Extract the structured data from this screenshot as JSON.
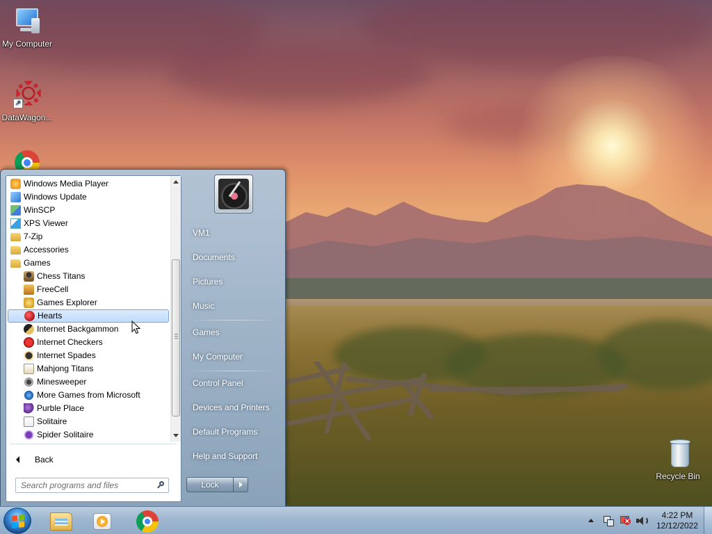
{
  "desktop": {
    "icons": [
      {
        "label": "My Computer",
        "icon": "my-computer-icon"
      },
      {
        "label": "DataWagon...",
        "icon": "datawagon-icon"
      },
      {
        "label": "Google Chrome",
        "icon": "chrome-icon"
      },
      {
        "label": "Recycle Bin",
        "icon": "recycle-bin-icon"
      }
    ]
  },
  "start_menu": {
    "programs": [
      {
        "label": "Windows Media Player",
        "icon": "windows-media-player-icon",
        "indent": 0
      },
      {
        "label": "Windows Update",
        "icon": "windows-update-icon",
        "indent": 0
      },
      {
        "label": "WinSCP",
        "icon": "winscp-icon",
        "indent": 0
      },
      {
        "label": "XPS Viewer",
        "icon": "xps-viewer-icon",
        "indent": 0
      },
      {
        "label": "7-Zip",
        "icon": "folder-icon",
        "indent": 0
      },
      {
        "label": "Accessories",
        "icon": "folder-icon",
        "indent": 0
      },
      {
        "label": "Games",
        "icon": "folder-icon",
        "indent": 0
      },
      {
        "label": "Chess Titans",
        "icon": "chess-titans-icon",
        "indent": 1
      },
      {
        "label": "FreeCell",
        "icon": "freecell-icon",
        "indent": 1
      },
      {
        "label": "Games Explorer",
        "icon": "games-explorer-icon",
        "indent": 1
      },
      {
        "label": "Hearts",
        "icon": "hearts-icon",
        "indent": 1,
        "selected": true
      },
      {
        "label": "Internet Backgammon",
        "icon": "internet-backgammon-icon",
        "indent": 1
      },
      {
        "label": "Internet Checkers",
        "icon": "internet-checkers-icon",
        "indent": 1
      },
      {
        "label": "Internet Spades",
        "icon": "internet-spades-icon",
        "indent": 1
      },
      {
        "label": "Mahjong Titans",
        "icon": "mahjong-titans-icon",
        "indent": 1
      },
      {
        "label": "Minesweeper",
        "icon": "minesweeper-icon",
        "indent": 1
      },
      {
        "label": "More Games from Microsoft",
        "icon": "more-games-icon",
        "indent": 1
      },
      {
        "label": "Purble Place",
        "icon": "purble-place-icon",
        "indent": 1
      },
      {
        "label": "Solitaire",
        "icon": "solitaire-icon",
        "indent": 1
      },
      {
        "label": "Spider Solitaire",
        "icon": "spider-solitaire-icon",
        "indent": 1
      }
    ],
    "back_label": "Back",
    "search_placeholder": "Search programs and files",
    "user_name": "VM1",
    "right_items": [
      {
        "label": "Documents"
      },
      {
        "label": "Pictures"
      },
      {
        "label": "Music"
      },
      {
        "label": "Games"
      },
      {
        "label": "My Computer"
      },
      {
        "label": "Control Panel"
      },
      {
        "label": "Devices and Printers"
      },
      {
        "label": "Default Programs"
      },
      {
        "label": "Help and Support"
      }
    ],
    "lock_label": "Lock"
  },
  "taskbar": {
    "pinned": [
      {
        "name": "windows-explorer",
        "icon": "windows-explorer-icon"
      },
      {
        "name": "windows-media-player",
        "icon": "windows-media-player-icon"
      },
      {
        "name": "google-chrome",
        "icon": "chrome-icon"
      }
    ],
    "clock_time": "4:22 PM",
    "clock_date": "12/12/2022"
  },
  "colors": {
    "menu_selection": "#c1dcfc",
    "menu_frame": "#8da6c0",
    "taskbar": "#a0bad4"
  }
}
